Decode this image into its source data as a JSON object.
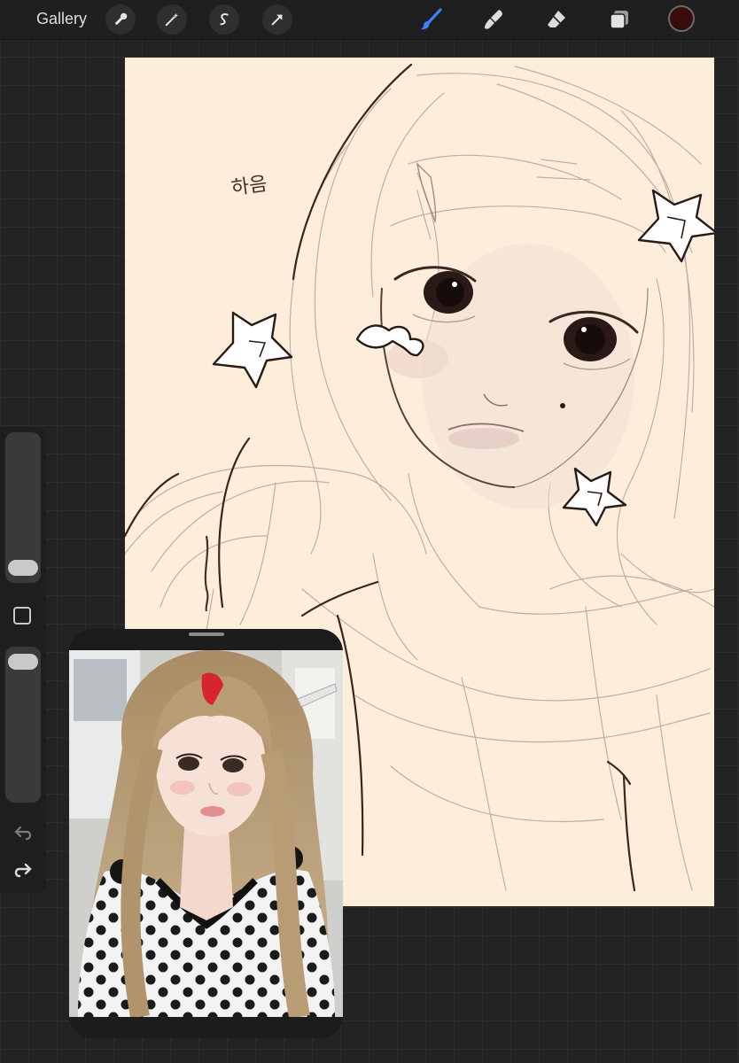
{
  "toolbar": {
    "gallery_label": "Gallery",
    "left_tools": [
      "wrench-icon",
      "magic-wand-icon",
      "selection-icon",
      "transform-arrow-icon"
    ],
    "right_tools": [
      "brush-icon",
      "smudge-icon",
      "eraser-icon",
      "layers-icon"
    ],
    "active_tool": "brush-icon",
    "active_tool_color": "#3b82f6",
    "current_color": "#3a0b0b"
  },
  "canvas": {
    "background": "#fdeddb",
    "handwritten_text": "하음",
    "stroke_color": "#4a2e2a"
  },
  "sidebar": {
    "brush_size_level": 0.85,
    "opacity_level": 0.0,
    "icons": [
      "modify-square-icon",
      "undo-icon",
      "redo-icon"
    ]
  },
  "reference": {
    "type": "reference-photo-window"
  }
}
